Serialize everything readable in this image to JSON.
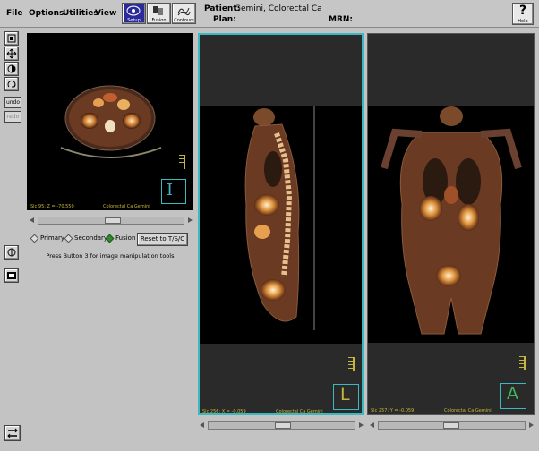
{
  "menubar": {
    "items": [
      "File",
      "Options",
      "Utilities",
      "View"
    ]
  },
  "toolbar": {
    "setup_label": "Setup",
    "fusion_label": "Fusion",
    "contours_label": "Contours",
    "help_label": "Help"
  },
  "patient": {
    "patient_label": "Patient:",
    "patient_value": "Gemini, Colorectal Ca",
    "plan_label": "Plan:",
    "plan_value": "",
    "mrn_label": "MRN:",
    "mrn_value": ""
  },
  "side_tools": {
    "undo_label": "undo",
    "redo_label": "redo"
  },
  "views": {
    "axial": {
      "info": "Slc 95: Z = -70.550",
      "series": "Colorectal Ca Gemini",
      "orientation": "I"
    },
    "sagittal": {
      "info": "Slc 256: X = -0.059",
      "series": "Colorectal Ca Gemini",
      "orientation": "L"
    },
    "coronal": {
      "info": "Slc 257: Y = -0.059",
      "series": "Colorectal Ca Gemini",
      "orientation": "A"
    }
  },
  "display_mode": {
    "options": [
      "Primary",
      "Secondary",
      "Fusion"
    ],
    "selected": "Fusion"
  },
  "reset_label": "Reset to T/S/C",
  "hint": "Press Button 3 for image manipulation tools.",
  "colors": {
    "active_border": "#3bb8c0",
    "overlay_text": "#c6b73a",
    "pet_hot": "#ffd28a"
  }
}
